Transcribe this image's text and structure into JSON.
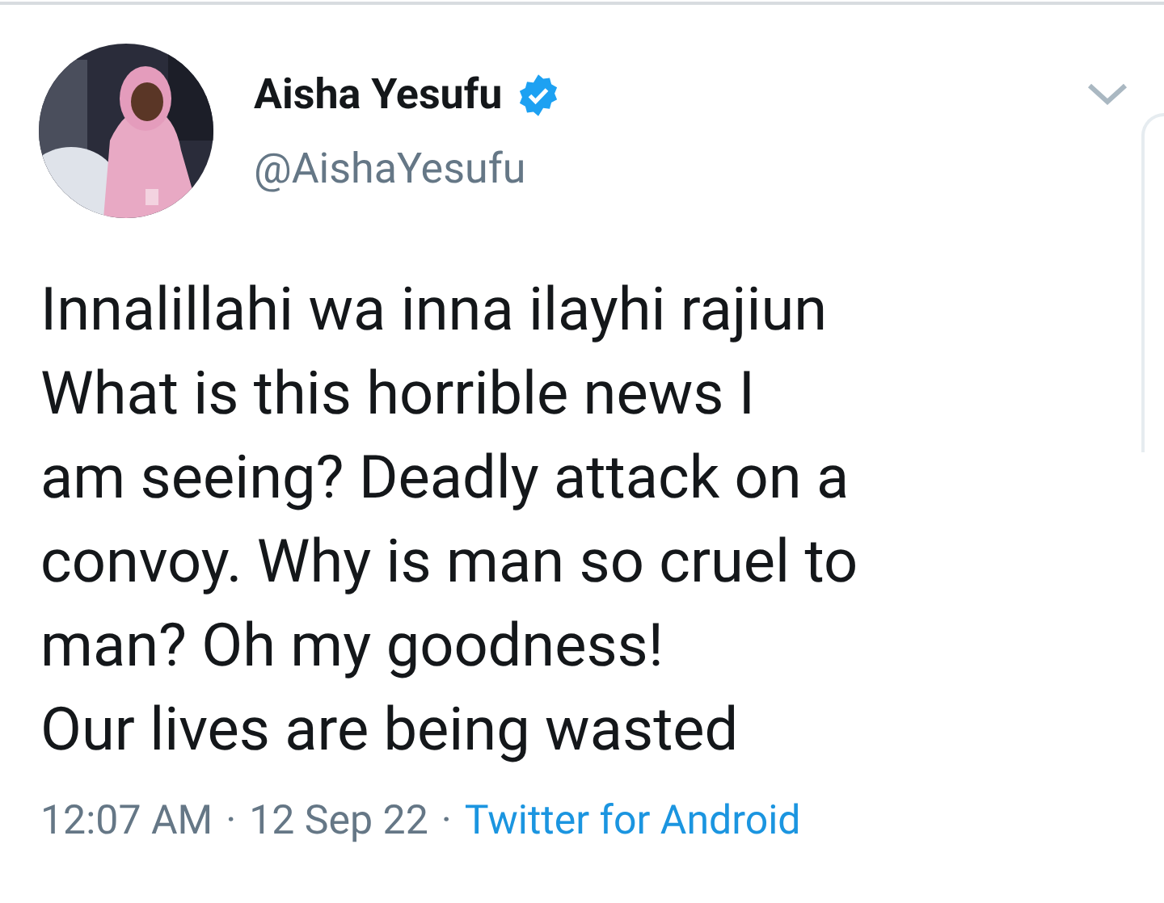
{
  "tweet": {
    "author": {
      "name": "Aisha Yesufu",
      "verified": true,
      "handle": "@AishaYesufu"
    },
    "text_lines": [
      "Innalillahi wa inna ilayhi rajiun",
      "What is this horrible news I",
      "am seeing? Deadly attack on a",
      "convoy. Why is man so cruel to",
      "man? Oh my goodness!",
      "Our lives are being wasted"
    ],
    "time": "12:07 AM",
    "separator_1": "·",
    "date": "12 Sep 22",
    "separator_2": "·",
    "source": "Twitter for Android"
  }
}
